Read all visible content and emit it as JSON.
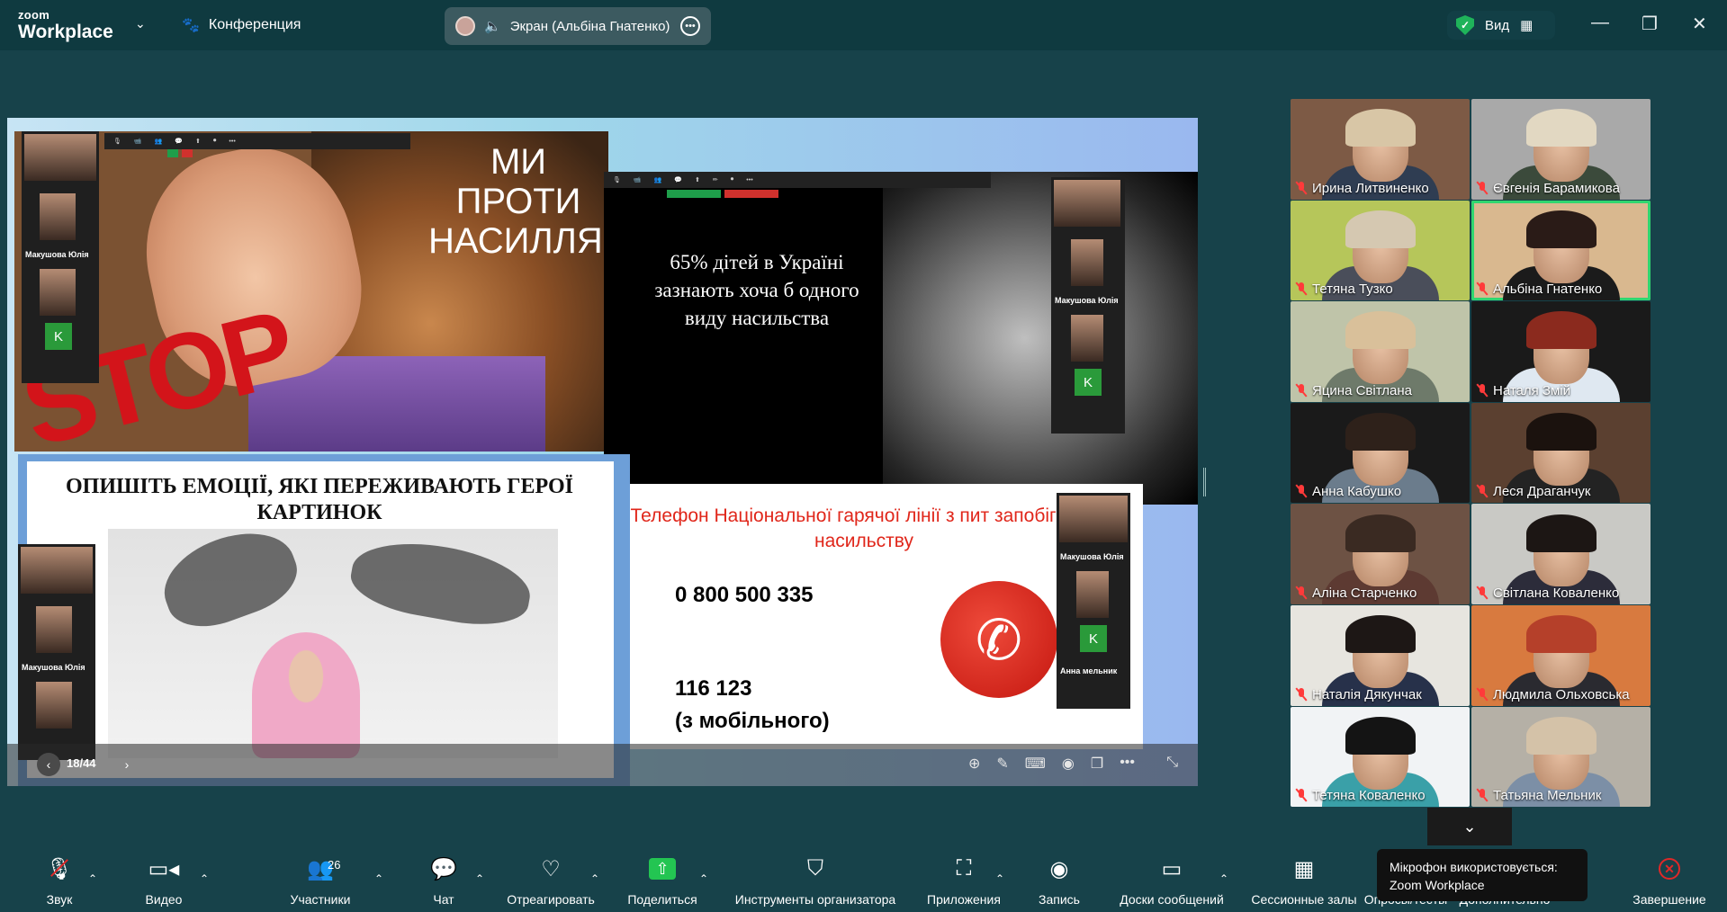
{
  "app": {
    "brand_line1": "zoom",
    "brand_line2": "Workplace",
    "conference_label": "Конференция",
    "screen_share_label": "Экран (Альбіна Гнатенко)",
    "view_label": "Вид"
  },
  "slides": {
    "slogan": "МИ ПРОТИ НАСИЛЛЯ!",
    "stop": "STOP",
    "stat": "65% дітей в Україні зазнають хоча б одного виду насильства",
    "task": "ОПИШІТЬ ЕМОЦІЇ, ЯКІ ПЕРЕЖИВАЮТЬ ГЕРОЇ КАРТИНОК",
    "hotline": "Телефон  Національної гарячої лінії з пит запобігання насильству",
    "number_1": "0 800 500 335",
    "number_2": "116 123",
    "number_2_note": "(з мобільного)",
    "mini_name": "Макушова Юлія",
    "mini_name_2": "Анна мельник",
    "mini_k": "K",
    "page_indicator": "18/44"
  },
  "participants": [
    {
      "name": "Ирина Литвиненко",
      "bg": "#7d5a45",
      "hair": "#d8c6a6",
      "shirt": "#2f3d52"
    },
    {
      "name": "Євгенія Барамикова",
      "bg": "#a9a9a9",
      "hair": "#e2d8c2",
      "shirt": "#3b4a3b"
    },
    {
      "name": "Тетяна Тузко",
      "bg": "#b6c65a",
      "hair": "#d5c8b1",
      "shirt": "#4a4e5a"
    },
    {
      "name": "Альбіна Гнатенко",
      "bg": "#d9b88f",
      "hair": "#2a1b17",
      "shirt": "#1b1b1b"
    },
    {
      "name": "Яцина Світлана",
      "bg": "#bfc4a9",
      "hair": "#d9c09a",
      "shirt": "#6e7a6a"
    },
    {
      "name": "Наталя Змій",
      "bg": "#1a1a1a",
      "hair": "#8b2a1e",
      "shirt": "#dfe8f1"
    },
    {
      "name": "Анна Кабушко",
      "bg": "#1a1a1a",
      "hair": "#2e211a",
      "shirt": "#6b7c8c"
    },
    {
      "name": "Леся Драганчук",
      "bg": "#5b4030",
      "hair": "#1b120e",
      "shirt": "#232323"
    },
    {
      "name": "Аліна Старченко",
      "bg": "#6d5244",
      "hair": "#3a2a22",
      "shirt": "#5d3a32"
    },
    {
      "name": "Світлана Коваленко",
      "bg": "#c9c9c5",
      "hair": "#1c1614",
      "shirt": "#2c2c3a"
    },
    {
      "name": "Наталія Дякунчак",
      "bg": "#e7e5df",
      "hair": "#1d1715",
      "shirt": "#27314a"
    },
    {
      "name": "Людмила Ольховська",
      "bg": "#d87a3f",
      "hair": "#b5402a",
      "shirt": "#2a2a30"
    },
    {
      "name": "Тетяна  Коваленко",
      "bg": "#f1f3f5",
      "hair": "#141414",
      "shirt": "#3aa0a8"
    },
    {
      "name": "Татьяна Мельник",
      "bg": "#b5b0a6",
      "hair": "#d4c2a8",
      "shirt": "#7c8fa6"
    }
  ],
  "toolbar": {
    "audio": "Звук",
    "video": "Видео",
    "participants": "Участники",
    "participants_count": "26",
    "chat": "Чат",
    "react": "Отреагировать",
    "share": "Поделиться",
    "host_tools": "Инструменты организатора",
    "apps": "Приложения",
    "record": "Запись",
    "whiteboards": "Доски сообщений",
    "breakout": "Сессионные залы",
    "polls": "Опросы/тесты",
    "more": "Дополнительно",
    "end": "Завершение"
  },
  "tooltip": {
    "line1": "Мікрофон використовується:",
    "line2": "Zoom Workplace"
  },
  "colors": {
    "background": "#17424a",
    "topbar": "#0f3a40",
    "active_speaker": "#30d670",
    "share_green": "#23c552",
    "end_red": "#e02828"
  }
}
